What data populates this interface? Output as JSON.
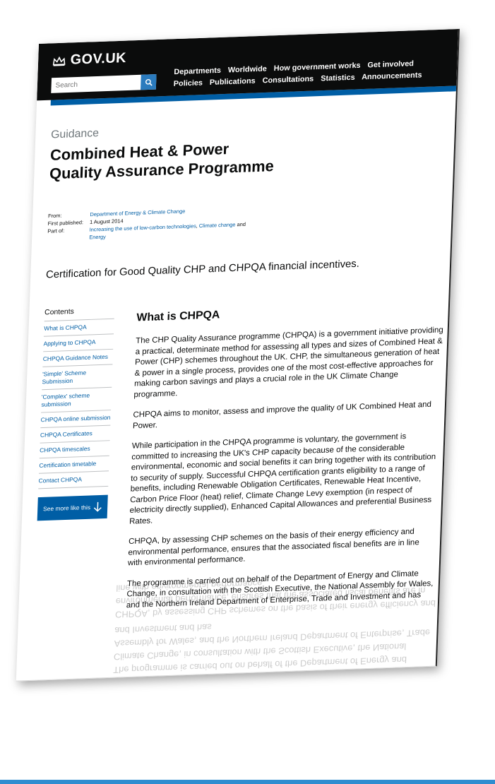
{
  "header": {
    "logo_text": "GOV.UK",
    "search_placeholder": "Search",
    "nav_row1": [
      "Departments",
      "Worldwide",
      "How government works",
      "Get involved"
    ],
    "nav_row2": [
      "Policies",
      "Publications",
      "Consultations",
      "Statistics",
      "Announcements"
    ]
  },
  "page": {
    "eyebrow": "Guidance",
    "title": "Combined Heat & Power Quality Assurance Programme",
    "meta": {
      "from_label": "From:",
      "from_value": "Department of Energy & Climate Change",
      "published_label": "First published:",
      "published_value": "1 August 2014",
      "part_label": "Part of:",
      "part_link1": "Increasing the use of low-carbon technologies",
      "part_sep": ", ",
      "part_link2": "Climate change",
      "part_and": " and ",
      "part_link3": "Energy"
    },
    "lede": "Certification for Good Quality CHP and CHPQA financial incentives."
  },
  "contents": {
    "title": "Contents",
    "items": [
      "What is CHPQA",
      "Applying to CHPQA",
      "CHPQA Guidance Notes",
      "'Simple' Scheme Submission",
      "'Complex' scheme submission",
      "CHPQA online submission",
      "CHPQA Certificates",
      "CHPQA timescales",
      "Certification timetable",
      "Contact CHPQA"
    ],
    "see_more": "See more like this"
  },
  "main": {
    "heading": "What is CHPQA",
    "paragraphs": [
      "The CHP Quality Assurance programme (CHPQA) is a government initiative providing a practical, determinate method for assessing all types and sizes of Combined Heat & Power (CHP) schemes throughout the UK. CHP, the simultaneous generation of heat & power in a single process, provides one of the most cost-effective approaches for making carbon savings and plays a crucial role in the UK Climate Change programme.",
      "CHPQA aims to monitor, assess and improve the quality of UK Combined Heat and Power.",
      "While participation in the CHPQA programme is voluntary, the government is committed to increasing the UK's CHP capacity because of the considerable environmental, economic and social benefits it can bring together with its contribution to security of supply. Successful CHPQA certification grants eligibility to a range of benefits, including Renewable Obligation Certificates, Renewable Heat Incentive, Carbon Price Floor (heat) relief, Climate Change Levy exemption (in respect of electricity directly supplied), Enhanced Capital Allowances and preferential Business Rates.",
      "CHPQA, by assessing CHP schemes on the basis of their energy efficiency and environmental performance, ensures that the associated fiscal benefits are in line with environmental performance.",
      "The programme is carried out on behalf of the Department of Energy and Climate Change, in consultation with the Scottish Executive, the National Assembly for Wales, and the Northern Ireland Department of Enterprise, Trade and Investment and has"
    ]
  },
  "colors": {
    "header_bg": "#0b0c0c",
    "link": "#005ea5",
    "search_button": "#2b7bbd",
    "bottom_line": "#2f8dd0"
  }
}
